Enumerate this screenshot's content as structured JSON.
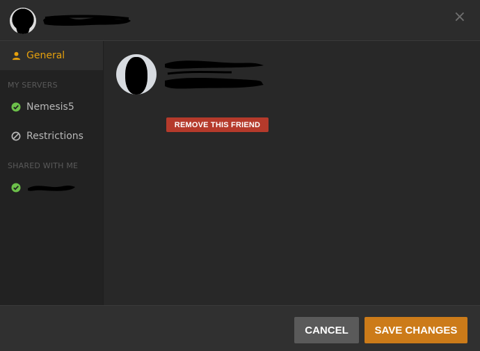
{
  "header": {
    "close_symbol": "×"
  },
  "sidebar": {
    "items": [
      {
        "label": "General",
        "icon": "user-icon",
        "active": true
      },
      {
        "label": "Nemesis5",
        "icon": "check-circle-icon"
      },
      {
        "label": "Restrictions",
        "icon": "ban-icon"
      }
    ],
    "sections": {
      "my_servers": "MY SERVERS",
      "shared_with_me": "SHARED WITH ME"
    },
    "shared_item_icon": "check-circle-icon"
  },
  "main": {
    "remove_label": "REMOVE THIS FRIEND"
  },
  "footer": {
    "cancel_label": "CANCEL",
    "save_label": "SAVE CHANGES"
  },
  "colors": {
    "accent": "#e5a00d",
    "save": "#cc7b19",
    "remove": "#b53a2b",
    "check": "#6cc04a"
  }
}
